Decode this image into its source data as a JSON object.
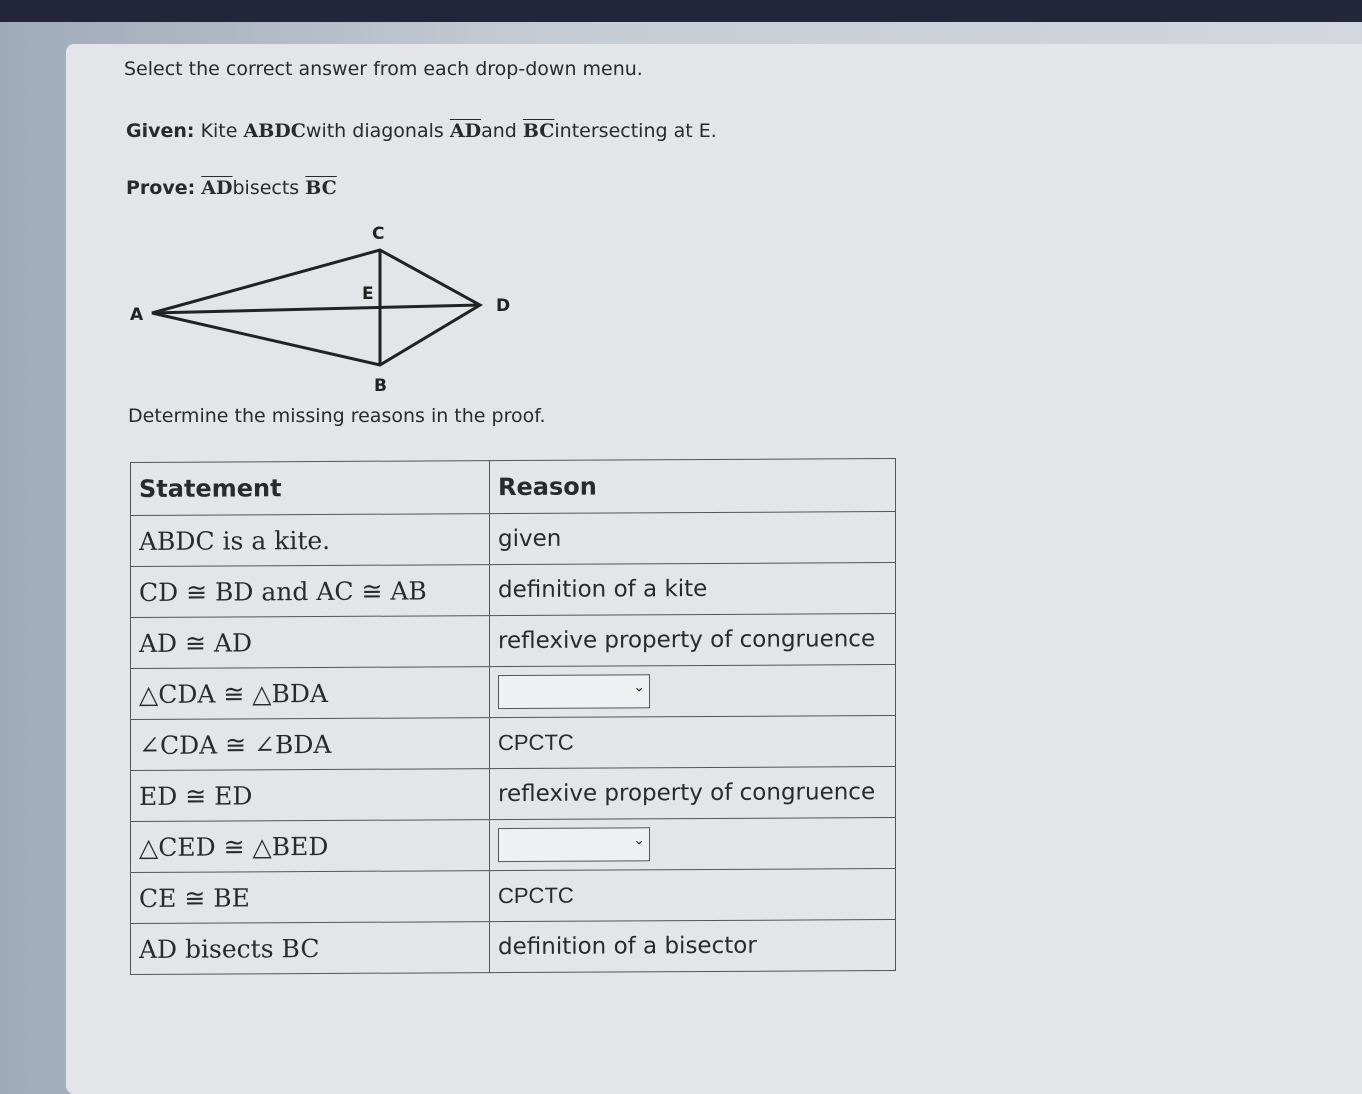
{
  "instruction": "Select the correct answer from each drop-down menu.",
  "given": {
    "label": "Given:",
    "pre": "Kite",
    "kite": "ABDC",
    "mid": "with diagonals",
    "d1": "AD",
    "and": "and",
    "d2": "BC",
    "post": "intersecting at E."
  },
  "prove": {
    "label": "Prove:",
    "s1": "AD",
    "mid": "bisects",
    "s2": "BC"
  },
  "diagram": {
    "points": [
      "A",
      "B",
      "C",
      "D",
      "E"
    ]
  },
  "determine": "Determine the missing reasons in the proof.",
  "table": {
    "headers": [
      "Statement",
      "Reason"
    ],
    "rows": [
      {
        "statement": "ABDC is a kite.",
        "reason": "given"
      },
      {
        "statement": "CD ≅ BD and AC ≅ AB",
        "reason": "definition of a kite"
      },
      {
        "statement": "AD ≅ AD",
        "reason": "reflexive property of congruence"
      },
      {
        "statement": "△CDA ≅ △BDA",
        "reason": "",
        "dropdown": true
      },
      {
        "statement": "∠CDA ≅ ∠BDA",
        "reason": "CPCTC"
      },
      {
        "statement": "ED ≅ ED",
        "reason": "reflexive property of congruence"
      },
      {
        "statement": "△CED ≅ △BED",
        "reason": "",
        "dropdown": true
      },
      {
        "statement": "CE ≅ BE",
        "reason": "CPCTC"
      },
      {
        "statement": "AD bisects BC",
        "reason": "definition of a bisector"
      }
    ]
  }
}
